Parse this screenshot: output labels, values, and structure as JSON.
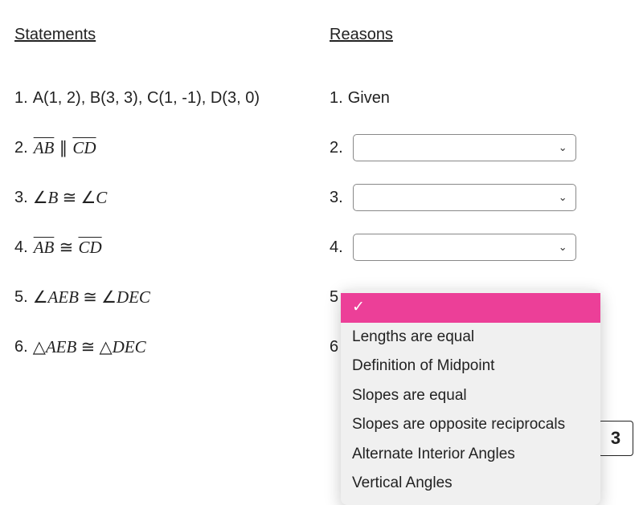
{
  "headers": {
    "statements": "Statements",
    "reasons": "Reasons"
  },
  "rows": {
    "r1": {
      "snum": "1.",
      "stmt_plain": "A(1, 2), B(3, 3), C(1, -1), D(3, 0)",
      "rnum": "1.",
      "reason_text": "Given"
    },
    "r2": {
      "snum": "2.",
      "rnum": "2."
    },
    "r3": {
      "snum": "3.",
      "rnum": "3."
    },
    "r4": {
      "snum": "4.",
      "rnum": "4."
    },
    "r5": {
      "snum": "5.",
      "rnum": "5"
    },
    "r6": {
      "snum": "6.",
      "rnum": "6"
    }
  },
  "math": {
    "r2": {
      "seg1": "AB",
      "par": " ∥ ",
      "seg2": "CD"
    },
    "r3": {
      "ang": "∠",
      "b": "B",
      "cong": " ≅ ",
      "c": "C"
    },
    "r4": {
      "seg1": "AB",
      "cong": " ≅ ",
      "seg2": "CD"
    },
    "r5": {
      "ang": "∠",
      "a": "AEB",
      "cong": " ≅ ",
      "b": "DEC"
    },
    "r6": {
      "tri": "△",
      "a": "AEB",
      "cong": " ≅ ",
      "b": "DEC"
    }
  },
  "dropdown": {
    "selected_check": "✓",
    "options": [
      "Lengths are equal",
      "Definition of Midpoint",
      "Slopes are equal",
      "Slopes are opposite reciprocals",
      "Alternate Interior Angles",
      "Vertical Angles"
    ]
  },
  "page_number": "3"
}
